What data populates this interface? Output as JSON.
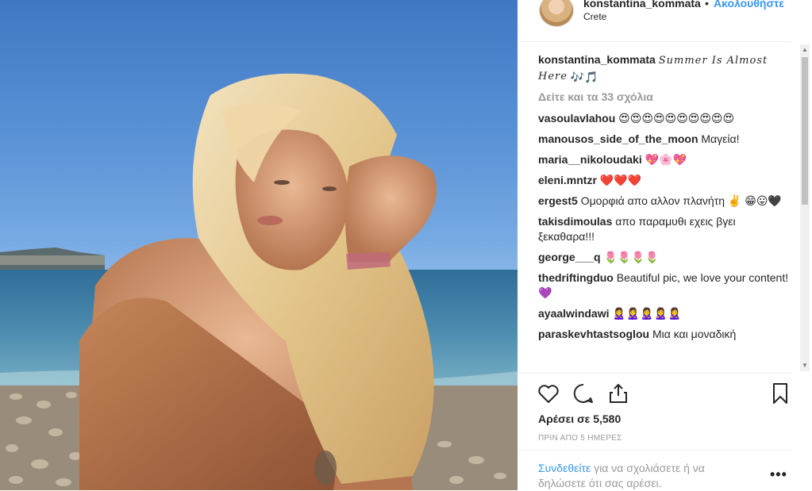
{
  "header": {
    "username": "konstantina_kommata",
    "dot": "•",
    "follow_label": "Ακολουθήστε",
    "location": "Crete"
  },
  "caption": {
    "username": "konstantina_kommata",
    "text": "Summer Is Almost Here",
    "emojis": "🎶🎵"
  },
  "view_all_comments": "Δείτε και τα 33 σχόλια",
  "comments": [
    {
      "user": "vasoulavlahou",
      "text": "😍😍😍😍😍😍😍😍😍😍"
    },
    {
      "user": "manousos_side_of_the_moon",
      "text": "Μαγεία!"
    },
    {
      "user": "maria__nikoloudaki",
      "text": "💖🌸💖"
    },
    {
      "user": "eleni.mntzr",
      "text": "❤️❤️❤️"
    },
    {
      "user": "ergest5",
      "text": "Ομορφιά απο αλλον πλανήτη ✌️ 😁😛🖤"
    },
    {
      "user": "takisdimoulas",
      "text": "απο παραμυθι εχεις βγει ξεκαθαρα!!!"
    },
    {
      "user": "george___q",
      "text": "🌷🌷🌷🌷"
    },
    {
      "user": "thedriftingduo",
      "text": "Beautiful pic, we love your content! 💜"
    },
    {
      "user": "ayaalwindawi",
      "text": "🙎‍♀️🙎‍♀️🙎‍♀️🙎‍♀️🙎‍♀️"
    },
    {
      "user": "paraskevhtastsoglou",
      "text": "Μια και μοναδική"
    }
  ],
  "actions": {
    "like_icon": "heart-outline-icon",
    "comment_icon": "speech-bubble-icon",
    "share_icon": "share-icon",
    "save_icon": "bookmark-icon"
  },
  "likes": "Αρέσει σε 5,580",
  "timestamp": "ΠΡΙΝ ΑΠΟ 5 ΗΜΕΡΕΣ",
  "login_prompt": {
    "link": "Συνδεθείτε",
    "text": " για να σχολιάσετε ή να δηλώσετε ότι σας αρέσει."
  },
  "options_label": "•••",
  "colors": {
    "link_blue": "#3897f0",
    "text_dark": "#262626",
    "text_gray": "#999999"
  }
}
